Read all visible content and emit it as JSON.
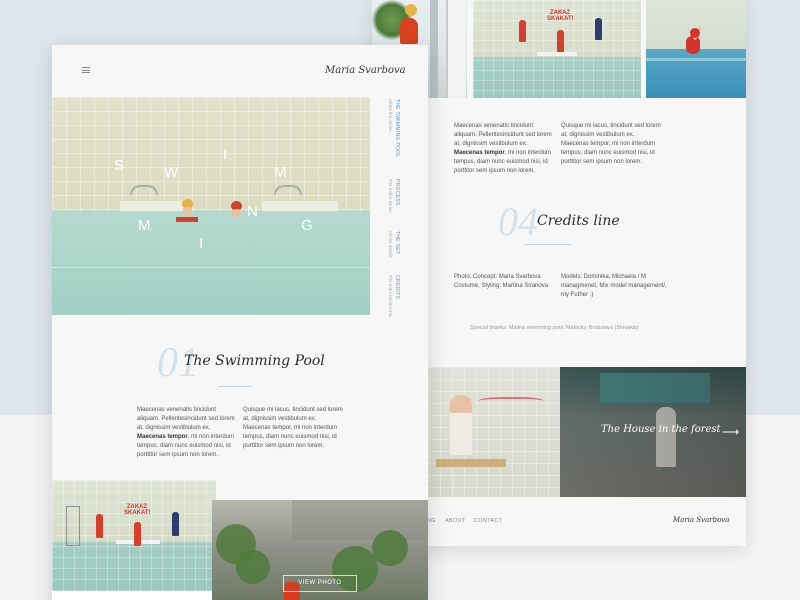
{
  "brand": {
    "name": "Maria Svarbova"
  },
  "hero": {
    "letters": [
      "S",
      "W",
      "I",
      "M",
      "M",
      "I",
      "N",
      "G"
    ]
  },
  "side_nav": [
    {
      "title": "THE SWIMMING POOL",
      "sub": "About the series"
    },
    {
      "title": "PROCESS",
      "sub": "The entire series"
    },
    {
      "title": "THE SET",
      "sub": "All the details"
    },
    {
      "title": "CREDITS",
      "sub": "The team behind this"
    }
  ],
  "section1": {
    "number": "01",
    "title": "The Swimming Pool",
    "col1_before": "Maecenas venenatis tincidunt aliquam. Pellentesincidunt sed lorem at, dignissim vestibulum ex. ",
    "col1_bold": "Maecenas tempor",
    "col1_after": ", mi non interdum tempus, diam nunc euismod nisi, id porttitor sem ipsum non lorem.",
    "col2": "Quisque mi lacus, tincidunt sed lorem at, dignissim vestibulum ex. Maecenas tempor, mi non interdum tempus, diam nunc euismod nisi, id porttitor sem ipsum non lorem."
  },
  "signs": {
    "pool_sign": "ZAKAZ SKAKAT!"
  },
  "view_photo": {
    "label": "VIEW PHOTO"
  },
  "back": {
    "col1_before": "Maecenas venenatis tincidunt aliquam. Pellentesincidunt sed lorem at, dignissim vestibulum ex. ",
    "col1_bold": "Maecenas tempor",
    "col1_after": ", mi non interdum tempus, diam nunc euismod nisi, id porttitor sem ipsum non lorem.",
    "col2": "Quisque mi lacus, tincidunt sed lorem at, dignissim vestibulum ex. Maecenas tempor, mi non interdum tempus, diam nunc euismod nisi, id porttitor sem ipsum non lorem."
  },
  "credits": {
    "number": "04",
    "title": "Credits line",
    "left": "Photo, Concept: Maria Svarbova Costume, Styling: Martina Siranova",
    "right": "Models: Dominika, Michaela / M managmenet, Mix model management/, my Futher :)",
    "thanks": "Special thanks: Malina swimming pool, Malacky, Bratislava (Slovakia)"
  },
  "next": {
    "title": "The House in the forest",
    "arrow": "⟶"
  },
  "footer": {
    "nav": [
      "ING",
      "ABOUT",
      "CONTACT"
    ],
    "brand": "Maria Svarbova"
  },
  "colors": {
    "accent": "#6d94b3",
    "number": "#d5e1ea",
    "red": "#d5402c"
  }
}
